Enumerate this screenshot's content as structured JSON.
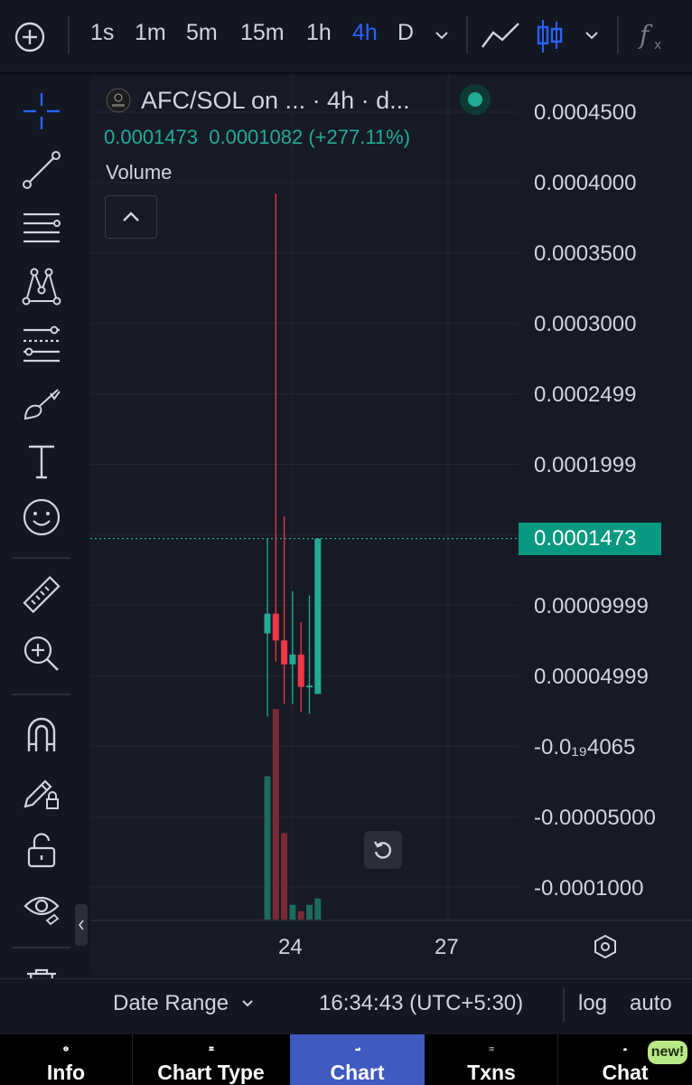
{
  "toolbar": {
    "intervals": [
      "1s",
      "1m",
      "5m",
      "15m",
      "1h",
      "4h",
      "D"
    ],
    "active_interval": "4h",
    "icons": [
      "add-circle-icon",
      "chevron-down-icon",
      "line-chart-icon",
      "candles-icon",
      "chevron-down-icon",
      "indicators-fx-icon"
    ]
  },
  "drawing_tools": [
    "crosshair-icon",
    "trend-line-icon",
    "horizontal-lines-icon",
    "pattern-icon",
    "fib-tool-icon",
    "brush-icon",
    "text-icon",
    "emoji-icon",
    "ruler-icon",
    "zoom-in-icon",
    "magnet-icon",
    "lock-draw-icon",
    "lock-icon",
    "eye-icon",
    "trash-icon"
  ],
  "legend": {
    "title": "AFC/SOL on ...  · 4h · d...",
    "close": "0.0001473",
    "change": "0.0001082 (+277.11%)",
    "volume_label": "Volume"
  },
  "colors": {
    "up": "#22ab94",
    "down": "#f23645",
    "active": "#2962ff",
    "background": "#131722"
  },
  "chart_data": {
    "type": "candlestick",
    "pair": "AFC/SOL",
    "interval": "4h",
    "last_price": 0.0001473,
    "y_tick_labels": [
      "0.0004500",
      "0.0004000",
      "0.0003500",
      "0.0003000",
      "0.0002499",
      "0.0001999",
      "0.00009999",
      "0.00004999",
      "-0.0₁₉4065",
      "-0.00005000",
      "-0.0001000"
    ],
    "ylim": [
      -0.0001,
      0.00045
    ],
    "x_tick_labels": [
      "24",
      "27"
    ],
    "candles": [
      {
        "open": 8e-05,
        "high": 0.000147,
        "low": 2.1e-05,
        "close": 9.4e-05,
        "dir": "up"
      },
      {
        "open": 9.4e-05,
        "high": 0.000392,
        "low": 6e-05,
        "close": 7.5e-05,
        "dir": "down"
      },
      {
        "open": 7.5e-05,
        "high": 0.000163,
        "low": 3e-05,
        "close": 5.8e-05,
        "dir": "down"
      },
      {
        "open": 5.8e-05,
        "high": 0.00011,
        "low": 3e-05,
        "close": 6.5e-05,
        "dir": "up"
      },
      {
        "open": 6.5e-05,
        "high": 8.8e-05,
        "low": 2.4e-05,
        "close": 4.2e-05,
        "dir": "down"
      },
      {
        "open": 4.2e-05,
        "high": 0.000107,
        "low": 2.3e-05,
        "close": 4.3e-05,
        "dir": "up"
      },
      {
        "open": 3.7e-05,
        "high": 0.000147,
        "low": 3.7e-05,
        "close": 0.0001473,
        "dir": "up"
      }
    ],
    "volume_relative": [
      0.68,
      1.0,
      0.41,
      0.07,
      0.04,
      0.07,
      0.1
    ],
    "grid": true
  },
  "status": {
    "date_range": "Date Range",
    "time": "16:34:43 (UTC+5:30)",
    "log": "log",
    "auto": "auto"
  },
  "nav": {
    "tabs": [
      "Info",
      "Chart Type",
      "Chart",
      "Txns",
      "Chat"
    ],
    "active": "Chart",
    "badge": "new!"
  }
}
